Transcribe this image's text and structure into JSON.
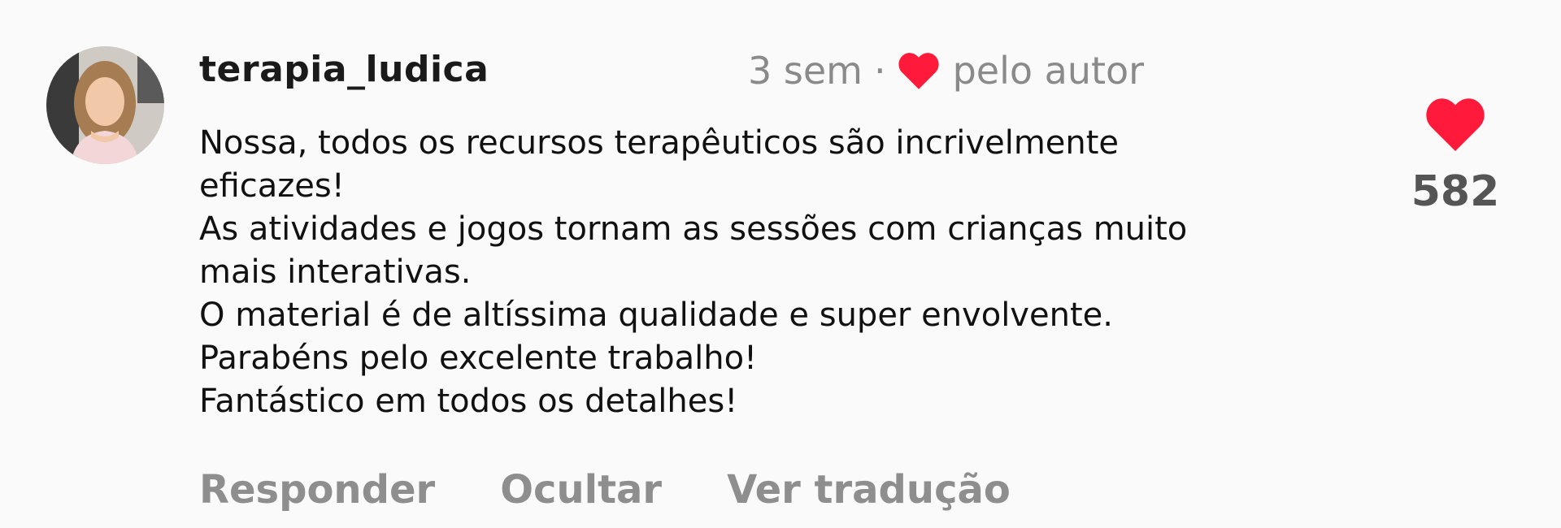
{
  "comment": {
    "username": "terapia_ludica",
    "time": "3 sem",
    "separator": "·",
    "liked_by_author_label": "pelo autor",
    "lines": [
      "Nossa, todos os recursos terapêuticos são incrivelmente",
      "eficazes!",
      "As atividades e jogos tornam as sessões com crianças muito",
      "mais interativas.",
      "O material é de altíssima qualidade e super envolvente.",
      "Parabéns pelo excelente trabalho!",
      "Fantástico em todos os detalhes!"
    ],
    "like_count": "582"
  },
  "actions": {
    "reply": "Responder",
    "hide": "Ocultar",
    "translate": "Ver tradução"
  },
  "colors": {
    "heart": "#ff1a3c",
    "muted_text": "#8e8e8e",
    "count_text": "#555555"
  },
  "icons": {
    "author_heart": "heart-icon",
    "like_heart": "heart-icon"
  }
}
